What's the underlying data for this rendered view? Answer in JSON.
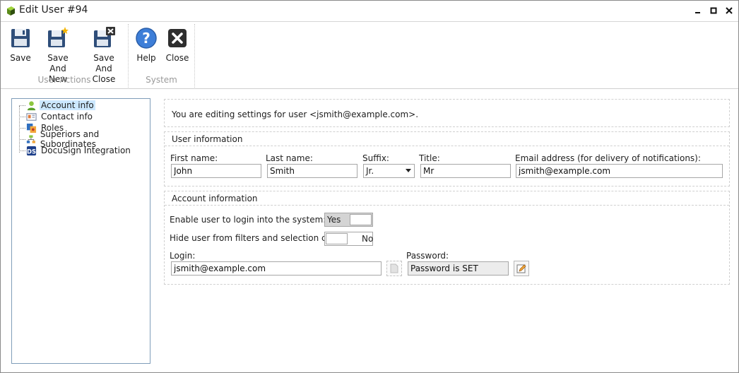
{
  "window": {
    "title": "Edit User #94"
  },
  "ribbon": {
    "groups": [
      {
        "caption": "User Actions"
      },
      {
        "caption": "System"
      }
    ],
    "buttons": {
      "save": "Save",
      "save_and_new_1": "Save And",
      "save_and_new_2": "New",
      "save_and_close_1": "Save And",
      "save_and_close_2": "Close",
      "help": "Help",
      "close": "Close"
    }
  },
  "tree": {
    "items": [
      {
        "label": "Account info",
        "icon": "user-icon",
        "selected": true
      },
      {
        "label": "Contact info",
        "icon": "contact-card-icon"
      },
      {
        "label": "Roles",
        "icon": "roles-icon"
      },
      {
        "label": "Superiors and Subordinates",
        "icon": "org-chart-icon"
      },
      {
        "label": "DocuSign Integration",
        "icon": "docusign-icon"
      }
    ]
  },
  "info": {
    "text": "You are editing settings for user <jsmith@example.com>."
  },
  "user_information": {
    "title": "User information",
    "first_name_label": "First name:",
    "first_name": "John",
    "last_name_label": "Last name:",
    "last_name": "Smith",
    "suffix_label": "Suffix:",
    "suffix": "Jr.",
    "title_label": "Title:",
    "title_value": "Mr",
    "email_label": "Email address (for delivery of notifications):",
    "email": "jsmith@example.com"
  },
  "account_information": {
    "title": "Account information",
    "enable_login_label": "Enable user to login into the system:",
    "enable_login_value": "Yes",
    "hide_user_label": "Hide user from filters and selection controls:",
    "hide_user_value": "No",
    "login_label": "Login:",
    "login": "jsmith@example.com",
    "password_label": "Password:",
    "password_status": "Password is SET"
  },
  "colors": {
    "selection": "#cce8ff",
    "tree_border": "#7f9db9",
    "help_blue": "#3d7ed8"
  }
}
